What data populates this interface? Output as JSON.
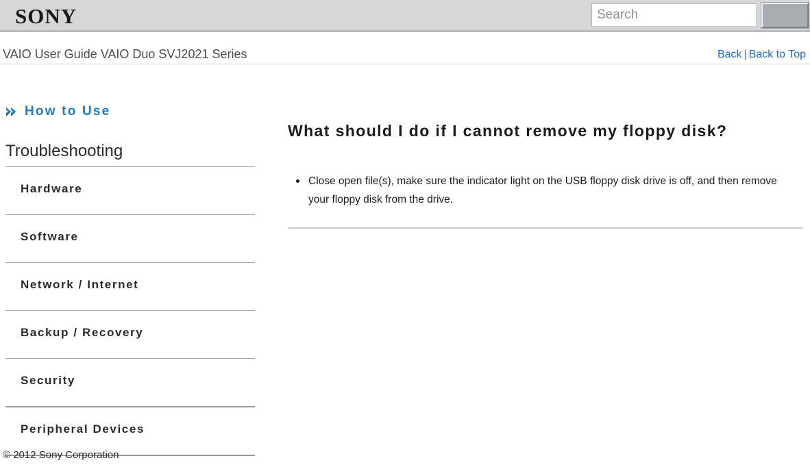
{
  "header": {
    "logo_text": "SONY",
    "search": {
      "placeholder": "Search",
      "value": "",
      "button_label": ""
    }
  },
  "titlebar": {
    "guide_title": "VAIO User Guide VAIO Duo SVJ2021 Series",
    "back_label": "Back",
    "separator": "|",
    "back_to_top_label": "Back to Top"
  },
  "sidebar": {
    "howto_label": "How to Use",
    "howto_icon": "double-chevron-right-icon",
    "section_title": "Troubleshooting",
    "items": [
      {
        "label": "Hardware"
      },
      {
        "label": "Software"
      },
      {
        "label": "Network / Internet"
      },
      {
        "label": "Backup / Recovery"
      },
      {
        "label": "Security"
      },
      {
        "label": "Peripheral Devices"
      }
    ]
  },
  "main": {
    "title": "What should I do if I cannot remove my floppy disk?",
    "bullets": [
      "Close open file(s), make sure the indicator light on the USB floppy disk drive is off, and then remove your floppy disk from the drive."
    ]
  },
  "footer": {
    "copyright": "© 2012 Sony Corporation"
  },
  "colors": {
    "header_bg": "#d5d7d9",
    "link_blue": "#1f6bbf",
    "accent_blue": "#1f7ac0",
    "text_dark": "#1c1c1c",
    "rule_gray": "#a9a9a9"
  }
}
